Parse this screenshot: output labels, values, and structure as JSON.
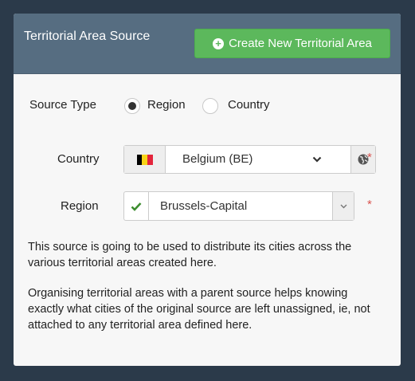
{
  "panel": {
    "title": "Territorial Area Source",
    "create_button_label": "Create New Territorial Area"
  },
  "form": {
    "source_type": {
      "label": "Source Type",
      "options": [
        {
          "label": "Region",
          "checked": true
        },
        {
          "label": "Country",
          "checked": false
        }
      ]
    },
    "country": {
      "label": "Country",
      "value": "Belgium (BE)",
      "flag_colors": [
        "#000000",
        "#f7d417",
        "#e3243b"
      ],
      "required_marker": "*"
    },
    "region": {
      "label": "Region",
      "value": "Brussels-Capital",
      "required_marker": "*"
    }
  },
  "description": {
    "paragraph1": "This source is going to be used to distribute its cities across the various territorial areas created here.",
    "paragraph2": "Organising territorial areas with a parent source helps knowing exactly what cities of the original source are left unassigned, ie, not attached to any territorial area defined here."
  },
  "icons": {
    "create": "plus-circle-icon",
    "globe": "globe-icon",
    "check": "check-icon",
    "chevron": "chevron-down-icon"
  },
  "colors": {
    "header_bg": "#566d81",
    "success": "#5cb85c",
    "required": "#d9534f",
    "check": "#3c8d2f"
  }
}
